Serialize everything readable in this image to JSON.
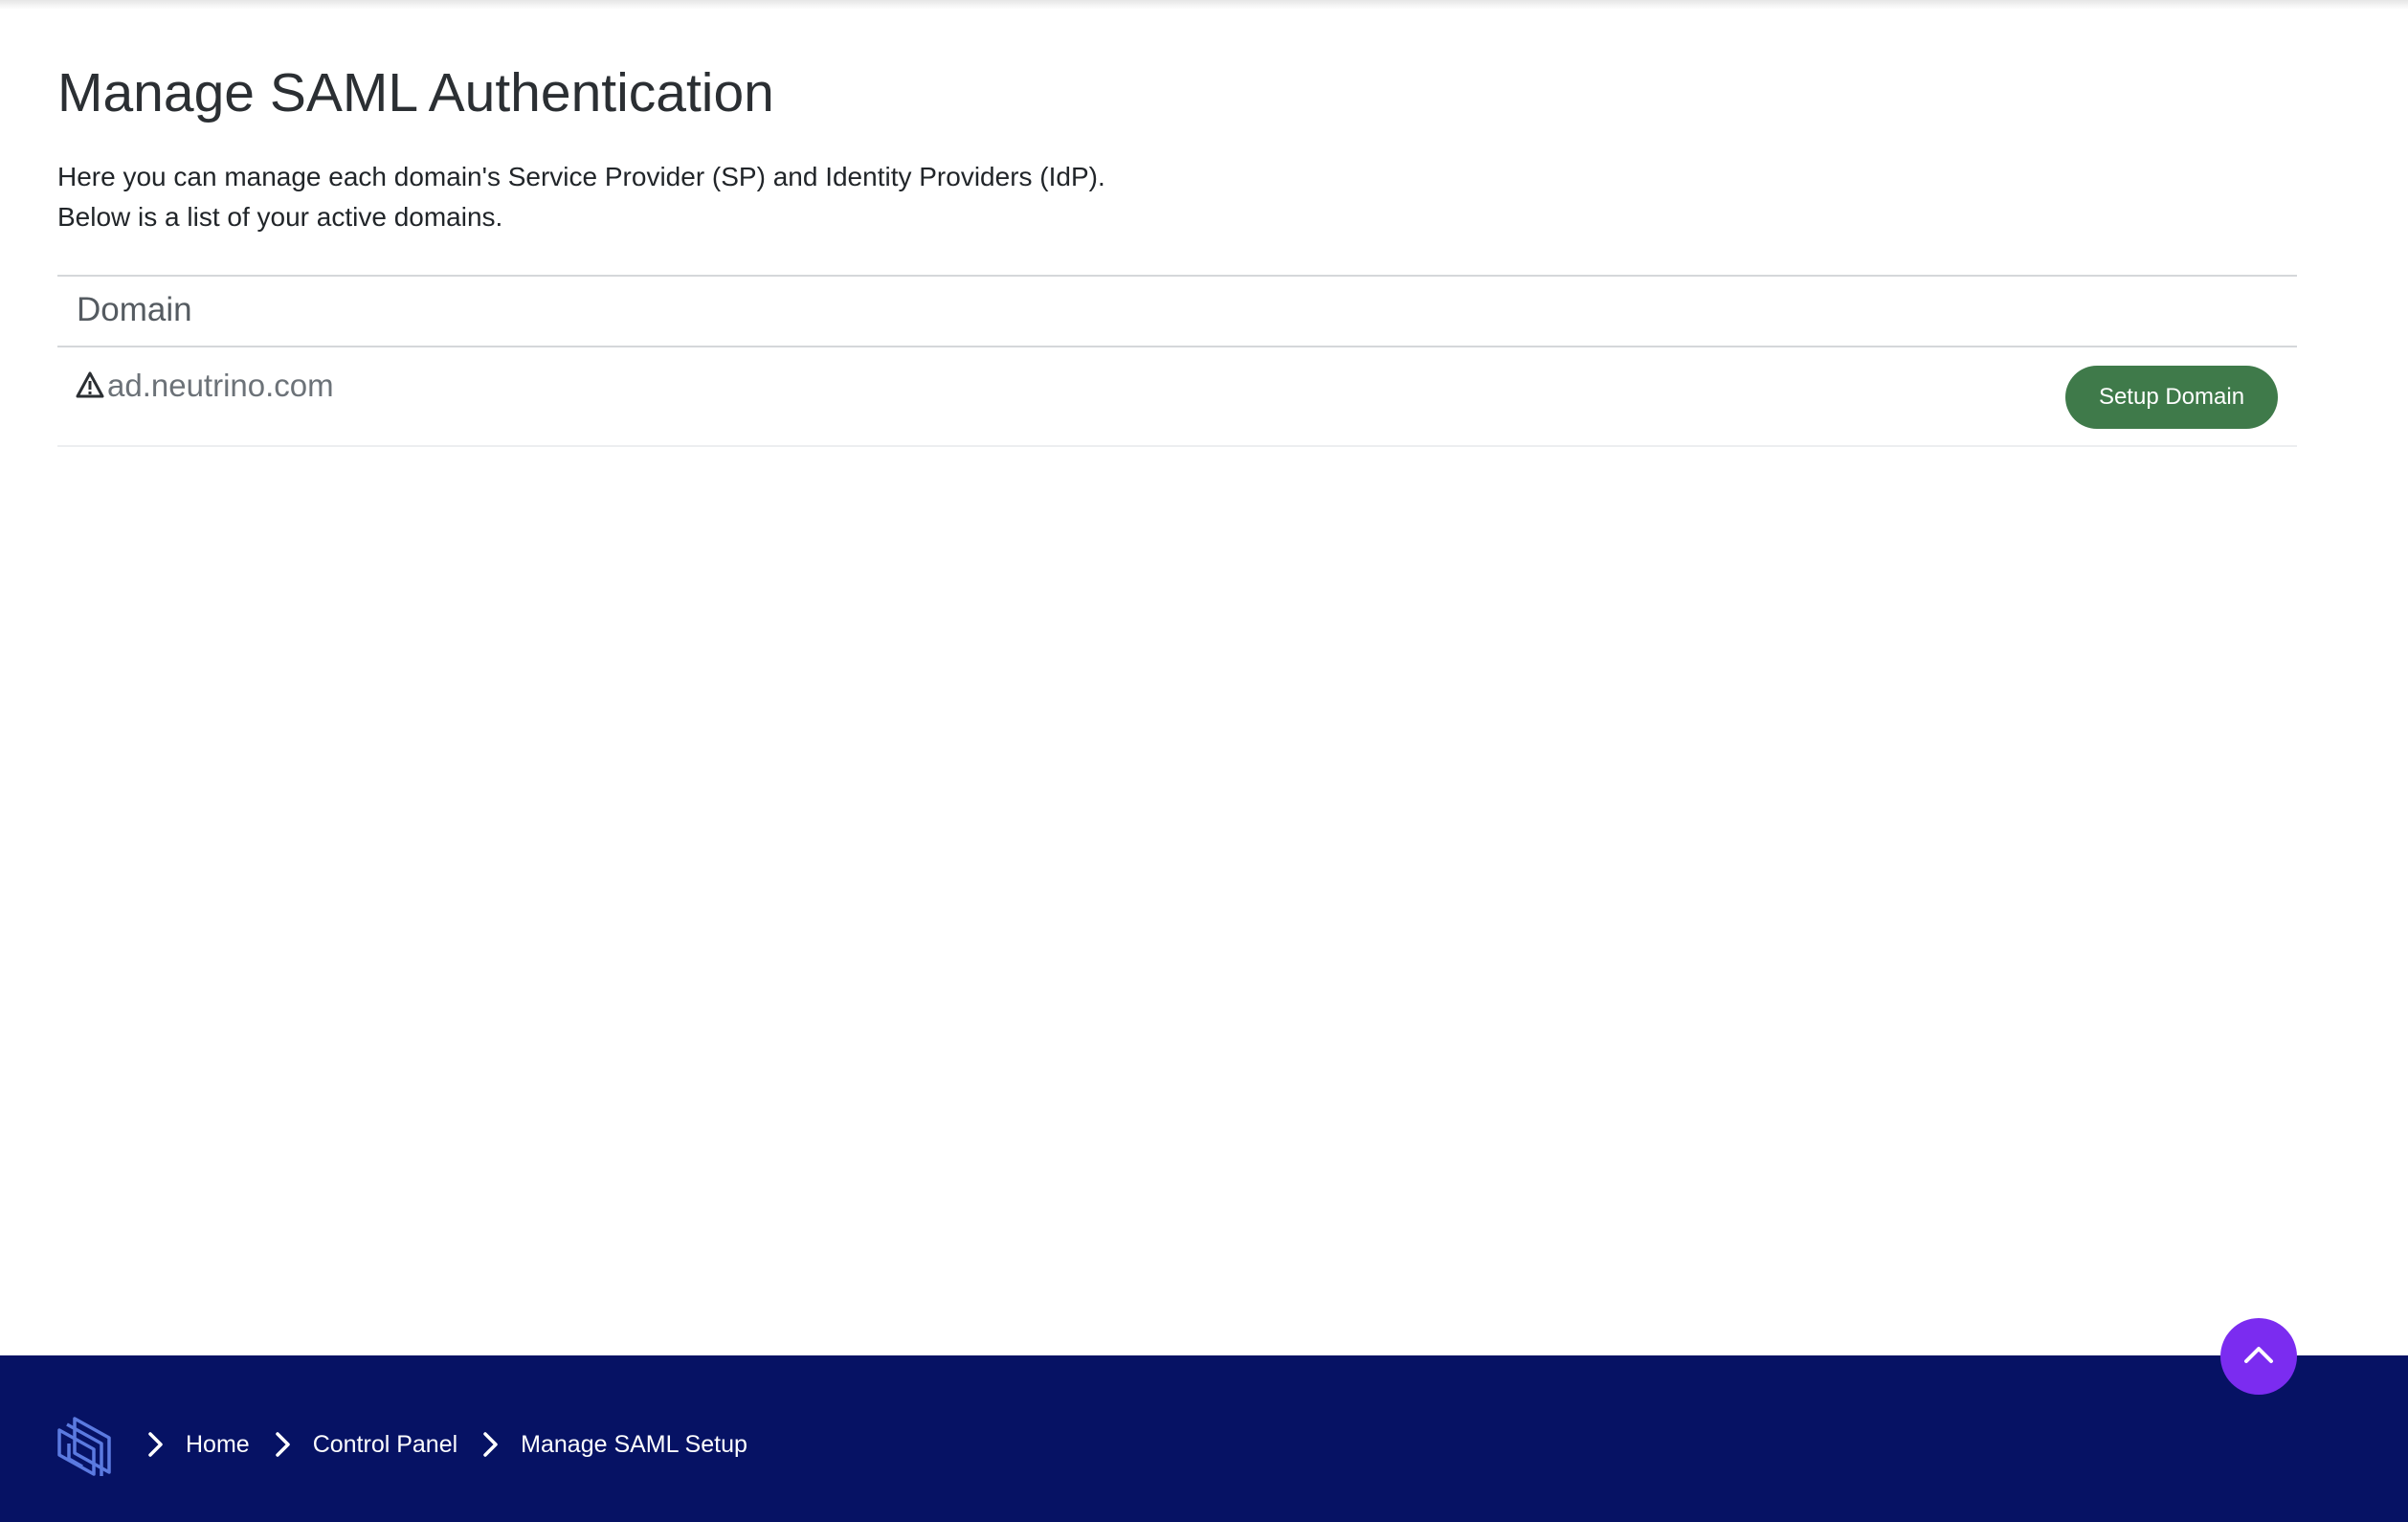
{
  "page": {
    "title": "Manage SAML Authentication",
    "intro_line1": "Here you can manage each domain's Service Provider (SP) and Identity Providers (IdP).",
    "intro_line2": "Below is a list of your active domains."
  },
  "table": {
    "column_header": "Domain",
    "rows": [
      {
        "status_icon": "warning-triangle-icon",
        "domain": "ad.neutrino.com",
        "action_label": "Setup Domain"
      }
    ]
  },
  "footer": {
    "logo_icon": "layers-logo-icon",
    "breadcrumb": [
      {
        "label": "Home"
      },
      {
        "label": "Control Panel"
      },
      {
        "label": "Manage SAML Setup"
      }
    ]
  },
  "colors": {
    "footer_bg": "#061264",
    "action_button": "#3f7a4a",
    "scroll_top_button": "#7b2cf0"
  },
  "icons": {
    "scroll_top": "chevron-up-icon",
    "breadcrumb_separator": "chevron-right-icon"
  }
}
